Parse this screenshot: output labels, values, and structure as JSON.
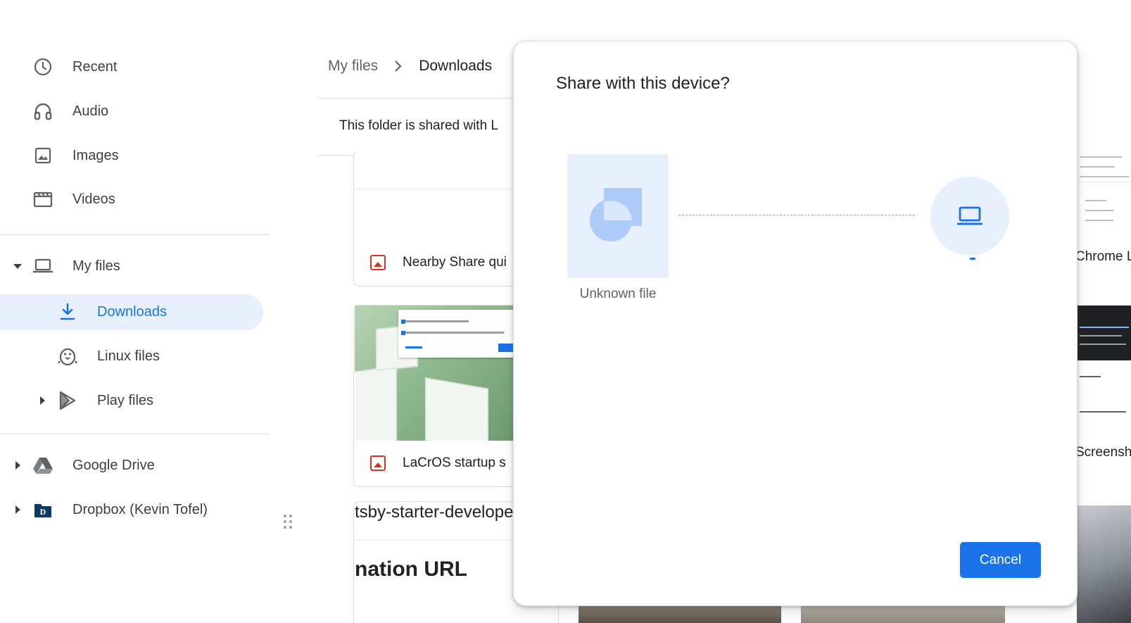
{
  "sidebar": {
    "items": [
      {
        "label": "Recent",
        "icon": "clock-icon"
      },
      {
        "label": "Audio",
        "icon": "headphones-icon"
      },
      {
        "label": "Images",
        "icon": "image-icon"
      },
      {
        "label": "Videos",
        "icon": "video-icon"
      },
      {
        "label": "My files",
        "icon": "laptop-icon",
        "expanded": true
      },
      {
        "label": "Downloads",
        "icon": "download-icon",
        "selected": true
      },
      {
        "label": "Linux files",
        "icon": "penguin-icon"
      },
      {
        "label": "Play files",
        "icon": "play-store-icon",
        "expanded": false
      },
      {
        "label": "Google Drive",
        "icon": "google-drive-icon",
        "expanded": false
      },
      {
        "label": "Dropbox (Kevin Tofel)",
        "icon": "dropbox-icon",
        "expanded": false
      }
    ]
  },
  "breadcrumb": {
    "root": "My files",
    "current": "Downloads"
  },
  "banner": {
    "text": "This folder is shared with L"
  },
  "files": {
    "items": [
      {
        "name": "Nearby Share qui",
        "type": "image"
      },
      {
        "name": "LaCrOS startup s",
        "type": "image"
      }
    ],
    "partial_texts": {
      "gatsby": "tsby-starter-develope",
      "destination": "nation URL"
    },
    "right_column": {
      "chrome": "Chrome L",
      "screenshot": "Screensh"
    }
  },
  "dialog": {
    "title": "Share with this device?",
    "file_label": "Unknown file",
    "cancel_label": "Cancel"
  },
  "colors": {
    "accent": "#1a73e8",
    "selected_bg": "#e8f0fe",
    "image_badge": "#d93025",
    "text_primary": "#202124",
    "text_secondary": "#5f6368"
  }
}
